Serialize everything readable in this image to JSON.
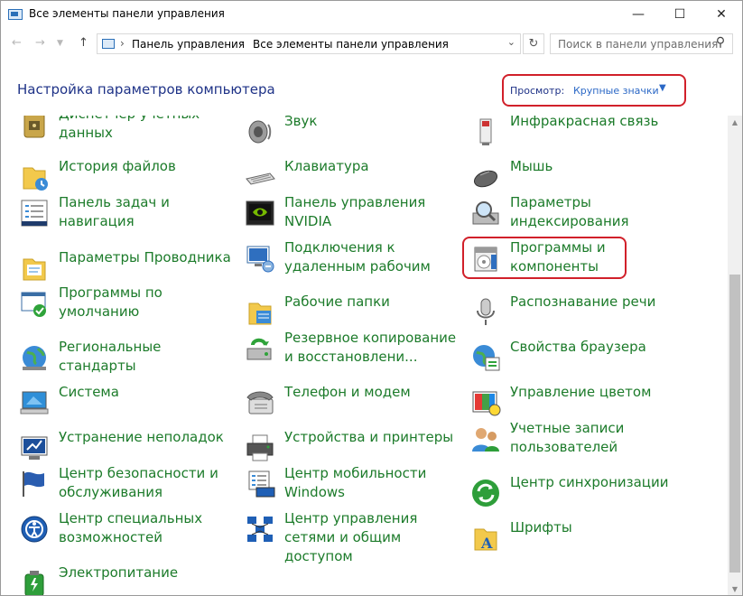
{
  "window": {
    "title": "Все элементы панели управления"
  },
  "address": {
    "crumbs": [
      "Панель управления",
      "Все элементы панели управления"
    ],
    "search_placeholder": "Поиск в панели управления"
  },
  "header": {
    "title": "Настройка параметров компьютера",
    "view_label": "Просмотр:",
    "view_value": "Крупные значки"
  },
  "items": {
    "col1": [
      {
        "label": "Диспетчер учетных данных",
        "icon": "credential-manager-icon"
      },
      {
        "label": "История файлов",
        "icon": "file-history-icon"
      },
      {
        "label": "Панель задач и навигация",
        "icon": "taskbar-icon"
      },
      {
        "label": "Параметры Проводника",
        "icon": "explorer-options-icon"
      },
      {
        "label": "Программы по умолчанию",
        "icon": "default-programs-icon"
      },
      {
        "label": "Региональные стандарты",
        "icon": "region-icon"
      },
      {
        "label": "Система",
        "icon": "system-icon"
      },
      {
        "label": "Устранение неполадок",
        "icon": "troubleshooting-icon"
      },
      {
        "label": "Центр безопасности и обслуживания",
        "icon": "security-center-icon"
      },
      {
        "label": "Центр специальных возможностей",
        "icon": "ease-of-access-icon"
      },
      {
        "label": "Электропитание",
        "icon": "power-options-icon"
      }
    ],
    "col2": [
      {
        "label": "Звук",
        "icon": "sound-icon"
      },
      {
        "label": "Клавиатура",
        "icon": "keyboard-icon"
      },
      {
        "label": "Панель управления NVIDIA",
        "icon": "nvidia-icon"
      },
      {
        "label": "Подключения к удаленным рабочим",
        "icon": "remote-desktop-icon"
      },
      {
        "label": "Рабочие папки",
        "icon": "work-folders-icon"
      },
      {
        "label": "Резервное копирование и восстановлени...",
        "icon": "backup-icon"
      },
      {
        "label": "Телефон и модем",
        "icon": "phone-modem-icon"
      },
      {
        "label": "Устройства и принтеры",
        "icon": "printer-icon"
      },
      {
        "label": "Центр мобильности Windows",
        "icon": "mobility-center-icon"
      },
      {
        "label": "Центр управления сетями и общим доступом",
        "icon": "network-center-icon"
      }
    ],
    "col3": [
      {
        "label": "Инфракрасная связь",
        "icon": "infrared-icon"
      },
      {
        "label": "Мышь",
        "icon": "mouse-icon"
      },
      {
        "label": "Параметры индексирования",
        "icon": "indexing-icon"
      },
      {
        "label": "Программы и компоненты",
        "icon": "programs-features-icon"
      },
      {
        "label": "Распознавание речи",
        "icon": "microphone-icon"
      },
      {
        "label": "Свойства браузера",
        "icon": "internet-options-icon"
      },
      {
        "label": "Управление цветом",
        "icon": "color-management-icon"
      },
      {
        "label": "Учетные записи пользователей",
        "icon": "user-accounts-icon"
      },
      {
        "label": "Центр синхронизации",
        "icon": "sync-center-icon"
      },
      {
        "label": "Шрифты",
        "icon": "fonts-icon"
      }
    ]
  },
  "colors": {
    "link_green": "#1c7b2a",
    "header_blue": "#1e3287",
    "highlight_red": "#d1202a"
  }
}
